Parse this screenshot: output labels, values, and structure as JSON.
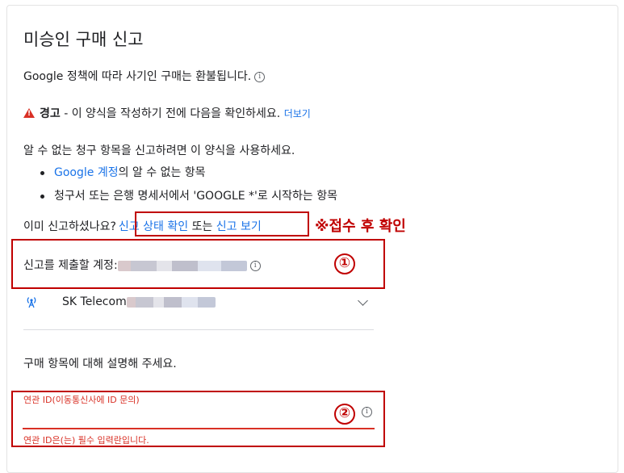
{
  "header": {
    "title": "미승인 구매 신고"
  },
  "policy": {
    "text": "Google 정책에 따라 사기인 구매는 환불됩니다."
  },
  "warning": {
    "label": "경고",
    "text": " - 이 양식을 작성하기 전에 다음을 확인하세요.",
    "more_link": "더보기"
  },
  "intro": {
    "text": "알 수 없는 청구 항목을 신고하려면 이 양식을 사용하세요."
  },
  "bullets": [
    {
      "link": "Google 계정",
      "rest": "의 알 수 없는 항목"
    },
    {
      "text": "청구서 또는 은행 명세서에서 'GOOGLE *'로 시작하는 항목"
    }
  ],
  "already": {
    "prefix": "이미 신고하셨나요?",
    "status_link": "신고 상태 확인",
    "or": "또는",
    "view_link": "신고 보기"
  },
  "annotation": {
    "note": "※접수 후 확인",
    "num1": "①",
    "num2": "②"
  },
  "account": {
    "label": "신고를 제출할 계정:"
  },
  "carrier": {
    "name": "SK Telecom"
  },
  "describe": {
    "text": "구매 항목에 대해 설명해 주세요."
  },
  "field": {
    "label": "연관 ID(이동통신사에 ID 문의)",
    "error": "연관 ID은(는) 필수 입력란입니다."
  },
  "colors": {
    "link": "#1a73e8",
    "error": "#d93025",
    "annotation": "#c00000"
  }
}
